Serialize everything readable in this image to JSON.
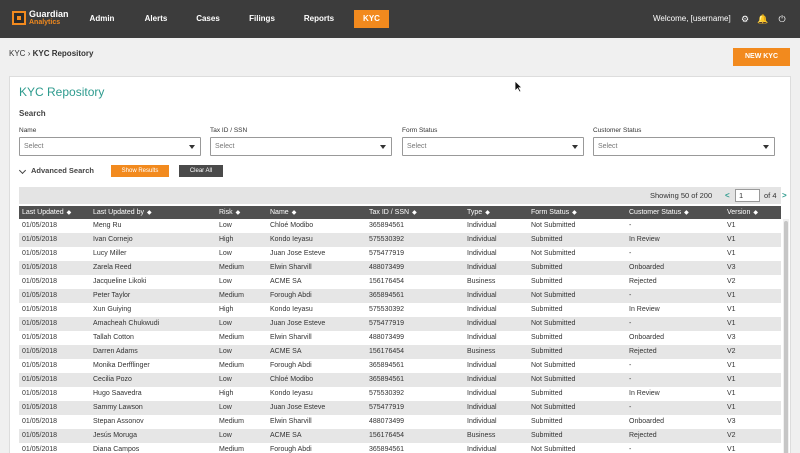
{
  "brand": {
    "name_line1": "Guardian",
    "name_line2": "Analytics"
  },
  "nav": {
    "items": [
      {
        "label": "Admin"
      },
      {
        "label": "Alerts"
      },
      {
        "label": "Cases"
      },
      {
        "label": "Filings"
      },
      {
        "label": "Reports"
      },
      {
        "label": "KYC"
      }
    ],
    "active": "KYC"
  },
  "header": {
    "welcome": "Welcome, [username]",
    "icons": [
      "gear-icon",
      "bell-icon",
      "power-icon"
    ]
  },
  "breadcrumb": {
    "root": "KYC",
    "current": "KYC Repository"
  },
  "actions": {
    "new_kyc": "NEW KYC"
  },
  "page_title": "KYC Repository",
  "search": {
    "heading": "Search",
    "fields": [
      {
        "label": "Name",
        "placeholder": "Select"
      },
      {
        "label": "Tax ID / SSN",
        "placeholder": "Select"
      },
      {
        "label": "Form Status",
        "placeholder": "Select"
      },
      {
        "label": "Customer Status",
        "placeholder": "Select"
      }
    ],
    "advanced_label": "Advanced Search",
    "show_results": "Show Results",
    "clear_all": "Clear All"
  },
  "pagination": {
    "showing": "Showing 50 of 200",
    "page": "1",
    "of": "of 4",
    "prev": "<",
    "next": ">"
  },
  "table": {
    "columns": [
      "Last Updated",
      "Last Updated by",
      "Risk",
      "Name",
      "Tax ID / SSN",
      "Type",
      "Form Status",
      "Customer Status",
      "Version"
    ],
    "rows": [
      [
        "01/05/2018",
        "Meng Ru",
        "Low",
        "Chloé Modibo",
        "365894561",
        "Individual",
        "Not Submitted",
        "-",
        "V1"
      ],
      [
        "01/05/2018",
        "Ivan Cornejo",
        "High",
        "Kondo Ieyasu",
        "575530392",
        "Individual",
        "Submitted",
        "In Review",
        "V1"
      ],
      [
        "01/05/2018",
        "Lucy Miller",
        "Low",
        "Juan Jose Esteve",
        "575477919",
        "Individual",
        "Not Submitted",
        "-",
        "V1"
      ],
      [
        "01/05/2018",
        "Zarela Reed",
        "Medium",
        "Elwin Sharvill",
        "488073499",
        "Individual",
        "Submitted",
        "Onboarded",
        "V3"
      ],
      [
        "01/05/2018",
        "Jacqueline Likoki",
        "Low",
        "ACME SA",
        "156176454",
        "Business",
        "Submitted",
        "Rejected",
        "V2"
      ],
      [
        "01/05/2018",
        "Peter Taylor",
        "Medium",
        "Forough Abdi",
        "365894561",
        "Individual",
        "Not Submitted",
        "-",
        "V1"
      ],
      [
        "01/05/2018",
        "Xun Guiying",
        "High",
        "Kondo Ieyasu",
        "575530392",
        "Individual",
        "Submitted",
        "In Review",
        "V1"
      ],
      [
        "01/05/2018",
        "Amacheah Chukwudi",
        "Low",
        "Juan Jose Esteve",
        "575477919",
        "Individual",
        "Not Submitted",
        "-",
        "V1"
      ],
      [
        "01/05/2018",
        "Tallah Cotton",
        "Medium",
        "Elwin Sharvill",
        "488073499",
        "Individual",
        "Submitted",
        "Onboarded",
        "V3"
      ],
      [
        "01/05/2018",
        "Darren Adams",
        "Low",
        "ACME SA",
        "156176454",
        "Business",
        "Submitted",
        "Rejected",
        "V2"
      ],
      [
        "01/05/2018",
        "Monika Derfflinger",
        "Medium",
        "Forough Abdi",
        "365894561",
        "Individual",
        "Not Submitted",
        "-",
        "V1"
      ],
      [
        "01/05/2018",
        "Cecilia Pozo",
        "Low",
        "Chloé Modibo",
        "365894561",
        "Individual",
        "Not Submitted",
        "-",
        "V1"
      ],
      [
        "01/05/2018",
        "Hugo Saavedra",
        "High",
        "Kondo Ieyasu",
        "575530392",
        "Individual",
        "Submitted",
        "In Review",
        "V1"
      ],
      [
        "01/05/2018",
        "Sammy Lawson",
        "Low",
        "Juan Jose Esteve",
        "575477919",
        "Individual",
        "Not Submitted",
        "-",
        "V1"
      ],
      [
        "01/05/2018",
        "Stepan Assonov",
        "Medium",
        "Elwin Sharvill",
        "488073499",
        "Individual",
        "Submitted",
        "Onboarded",
        "V3"
      ],
      [
        "01/05/2018",
        "Jesús Moruga",
        "Low",
        "ACME SA",
        "156176454",
        "Business",
        "Submitted",
        "Rejected",
        "V2"
      ],
      [
        "01/05/2018",
        "Diana Campos",
        "Medium",
        "Forough Abdi",
        "365894561",
        "Individual",
        "Not Submitted",
        "-",
        "V1"
      ]
    ]
  },
  "colors": {
    "accent": "#f28a1e",
    "title": "#2e9b8e",
    "topbar": "#3c3c3c",
    "table_header": "#505050"
  }
}
